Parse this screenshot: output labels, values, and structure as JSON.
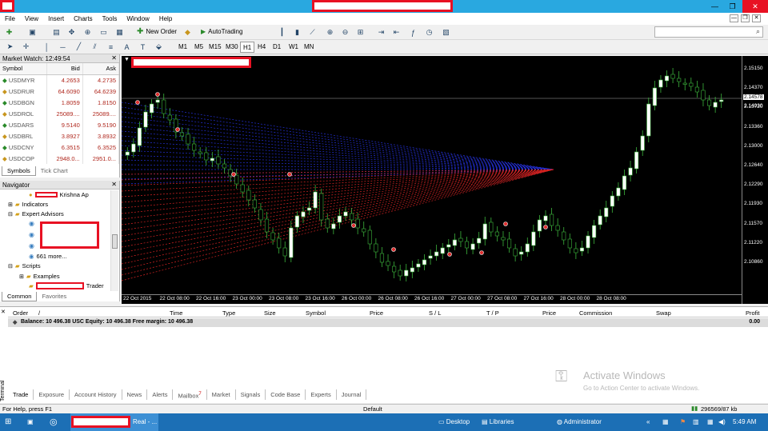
{
  "window": {
    "min": "—",
    "restore": "❐",
    "close": "✕"
  },
  "menu": [
    "File",
    "View",
    "Insert",
    "Charts",
    "Tools",
    "Window",
    "Help"
  ],
  "toolbar": {
    "new_order": "New Order",
    "autotrading": "AutoTrading"
  },
  "timeframes": [
    "M1",
    "M5",
    "M15",
    "M30",
    "H1",
    "H4",
    "D1",
    "W1",
    "MN"
  ],
  "market_watch": {
    "title": "Market Watch: 12:49:54",
    "columns": [
      "Symbol",
      "Bid",
      "Ask"
    ],
    "rows": [
      [
        "USDMYR",
        "4.2653",
        "4.2735"
      ],
      [
        "USDRUR",
        "64.6090",
        "64.6239"
      ],
      [
        "USDBGN",
        "1.8059",
        "1.8150"
      ],
      [
        "USDROL",
        "25089....",
        "25089...."
      ],
      [
        "USDARS",
        "9.5140",
        "9.5190"
      ],
      [
        "USDBRL",
        "3.8927",
        "3.8932"
      ],
      [
        "USDCNY",
        "6.3515",
        "6.3525"
      ],
      [
        "USDCOP",
        "2948.0...",
        "2951.0..."
      ]
    ],
    "tabs": [
      "Symbols",
      "Tick Chart"
    ]
  },
  "navigator": {
    "title": "Navigator",
    "account_suffix": "Krishna  Ap",
    "indicators": "Indicators",
    "expert_advisors": "Expert Advisors",
    "more": "661 more...",
    "scripts": "Scripts",
    "examples": "Examples",
    "trader_suffix": "Trader",
    "tabs": [
      "Common",
      "Favorites"
    ]
  },
  "chart": {
    "price_labels": [
      "2.15150",
      "2.14370",
      "2.13720",
      "2.13360",
      "2.13000",
      "2.12640",
      "2.12290",
      "2.11930",
      "2.11570",
      "2.11220",
      "2.10860"
    ],
    "current_price": "2.14578",
    "time_labels": [
      "22 Oct 2015",
      "22 Oct 08:00",
      "22 Oct 16:00",
      "23 Oct 00:00",
      "23 Oct 08:00",
      "23 Oct 16:00",
      "26 Oct 00:00",
      "26 Oct 08:00",
      "26 Oct 16:00",
      "27 Oct 00:00",
      "27 Oct 08:00",
      "27 Oct 16:00",
      "28 Oct 00:00",
      "28 Oct 08:00"
    ],
    "price_4": "2.14030"
  },
  "terminal": {
    "columns": [
      "Order",
      "/",
      "Time",
      "Type",
      "Size",
      "Symbol",
      "Price",
      "S / L",
      "T / P",
      "Price",
      "Commission",
      "Swap",
      "Profit"
    ],
    "balance_text": "Balance: 10 496.38 USC  Equity: 10 496.38  Free margin: 10 496.38",
    "profit": "0.00",
    "side_label": "Terminal",
    "tabs": [
      "Trade",
      "Exposure",
      "Account History",
      "News",
      "Alerts",
      "Mailbox",
      "Market",
      "Signals",
      "Code Base",
      "Experts",
      "Journal"
    ],
    "mailbox_badge": "7",
    "watermark_title": "Activate Windows",
    "watermark_sub": "Go to Action Center to activate Windows."
  },
  "status": {
    "help": "For Help, press F1",
    "profile": "Default",
    "traffic": "296569/87 kb"
  },
  "taskbar": {
    "app_suffix": "Real - ...",
    "desktop": "Desktop",
    "libraries": "Libraries",
    "user": "Administrator",
    "clock": "5:49 AM"
  }
}
